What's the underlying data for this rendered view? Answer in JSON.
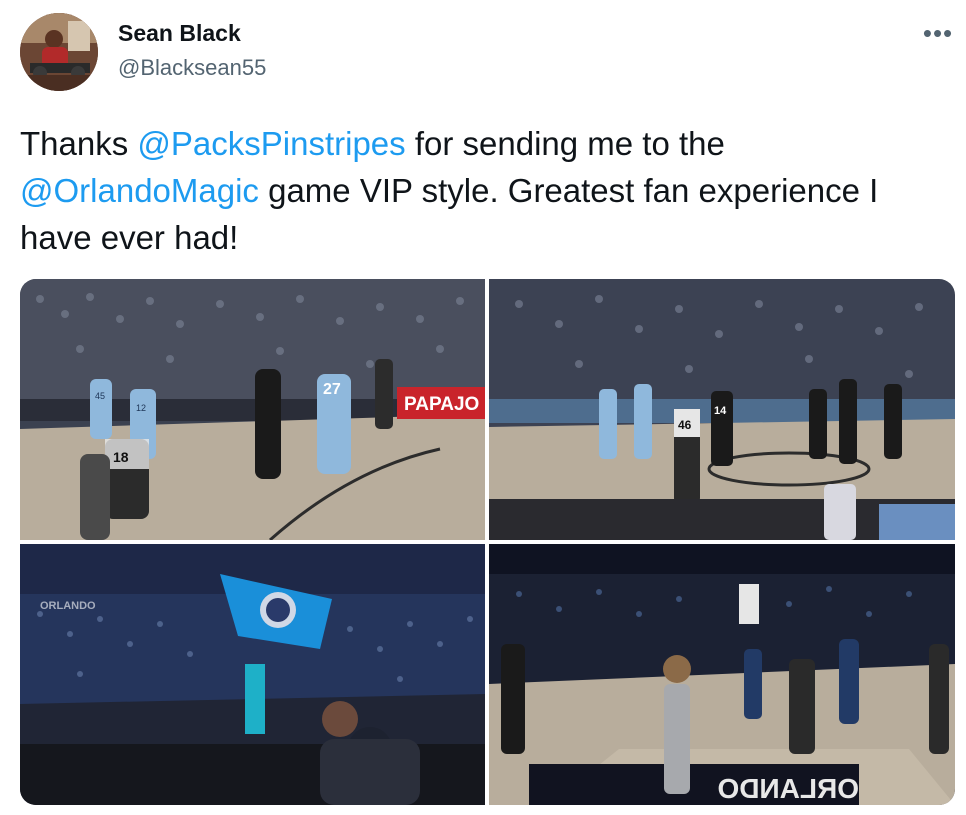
{
  "tweet": {
    "author_name": "Sean Black",
    "author_handle": "@Blacksean55",
    "more_label": "•••",
    "text_parts": {
      "p1": "Thanks ",
      "mention1": "@PacksPinstripes",
      "p2": " for sending me to the ",
      "mention2": "@OrlandoMagic",
      "p3": " game VIP style. Greatest fan experience I have ever had!"
    }
  },
  "photos": {
    "photo1": {
      "banner": "PAPAJO",
      "jersey_a": "27",
      "jersey_b": "12",
      "jersey_c": "45",
      "ref_number": "18"
    },
    "photo2": {
      "ref_number": "46",
      "jersey_a": "14"
    },
    "photo3": {
      "banner": "ORLANDO"
    },
    "photo4": {
      "floor_text": "ORLANDO"
    }
  },
  "colors": {
    "link": "#1d9bf0",
    "text": "#0f1419",
    "secondary": "#536471",
    "magic_blue": "#0077c0",
    "court": "#b8ad9c"
  }
}
